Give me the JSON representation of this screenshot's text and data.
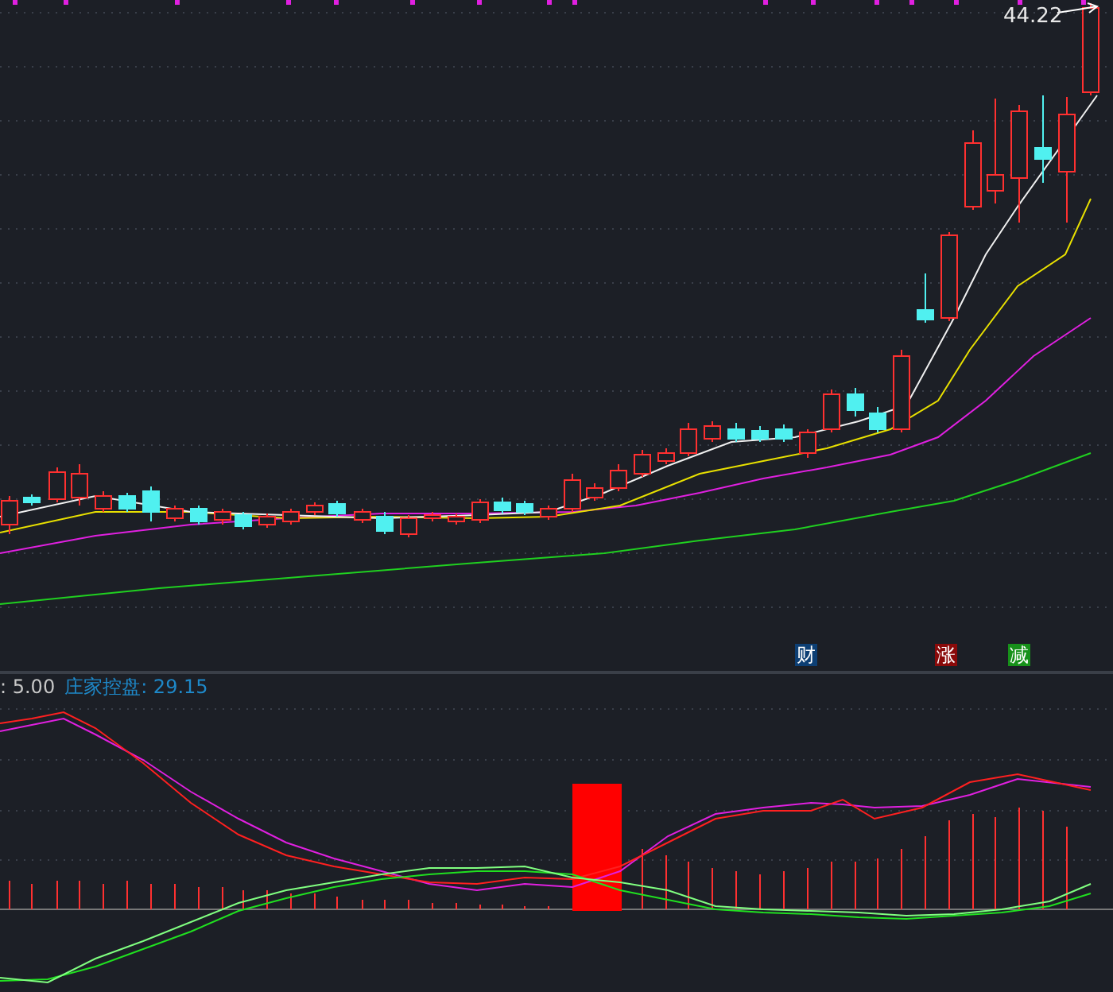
{
  "price_chart": {
    "last_price": "44.22",
    "markers": [
      {
        "label": "财",
        "color": "#0d3f74"
      },
      {
        "label": "涨",
        "color": "#8a0a0a"
      },
      {
        "label": "减",
        "color": "#17911a"
      }
    ]
  },
  "indicator": {
    "legend": [
      {
        "text": ": 5.00",
        "color": "#c8c8c8"
      },
      {
        "text": "庄家控盘: 29.15",
        "color": "#1e88c8"
      }
    ]
  }
}
